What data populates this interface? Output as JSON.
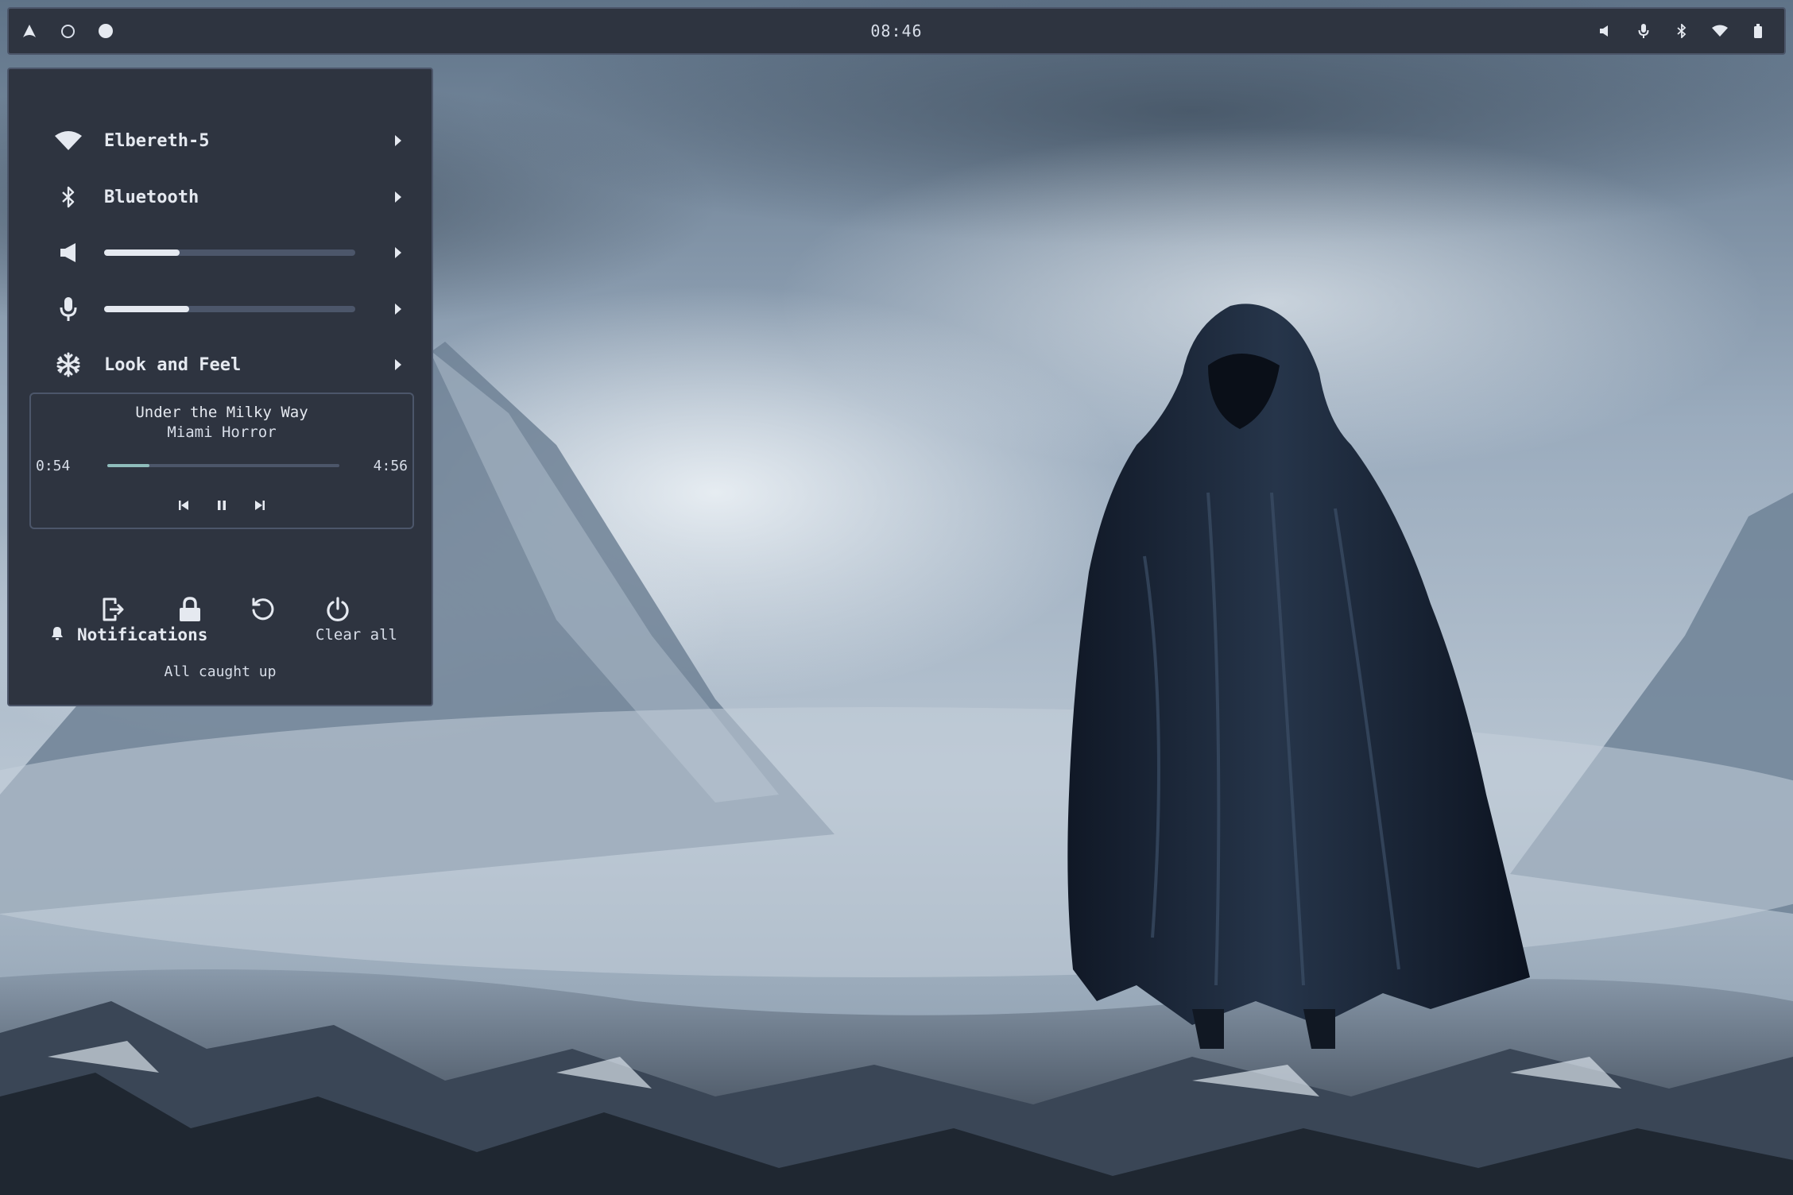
{
  "topbar": {
    "clock": "08:46",
    "left_icons": [
      "arch-logo-icon",
      "workspace-empty-icon",
      "workspace-active-icon"
    ],
    "right_icons": [
      "volume-icon",
      "microphone-icon",
      "bluetooth-icon",
      "wifi-icon",
      "battery-icon"
    ]
  },
  "panel": {
    "wifi": {
      "label": "Elbereth-5",
      "icon": "wifi-icon"
    },
    "bluetooth": {
      "label": "Bluetooth",
      "icon": "bluetooth-icon"
    },
    "volume": {
      "icon": "volume-icon",
      "level_percent": 30
    },
    "microphone": {
      "icon": "microphone-icon",
      "level_percent": 34
    },
    "look_and_feel": {
      "label": "Look and Feel",
      "icon": "snowflake-icon"
    },
    "media": {
      "title": "Under the Milky Way",
      "artist": "Miami Horror",
      "position": "0:54",
      "duration": "4:56",
      "progress_percent": 18
    },
    "session_icons": [
      "logout-icon",
      "lock-icon",
      "restart-icon",
      "power-icon"
    ],
    "notifications": {
      "title": "Notifications",
      "clear_label": "Clear all",
      "empty_text": "All caught up"
    }
  },
  "colors": {
    "panel_bg": "#2e3440",
    "border": "#4c566a",
    "text": "#e5e9f0",
    "track": "#4c566a",
    "accent": "#8fbcbb"
  }
}
